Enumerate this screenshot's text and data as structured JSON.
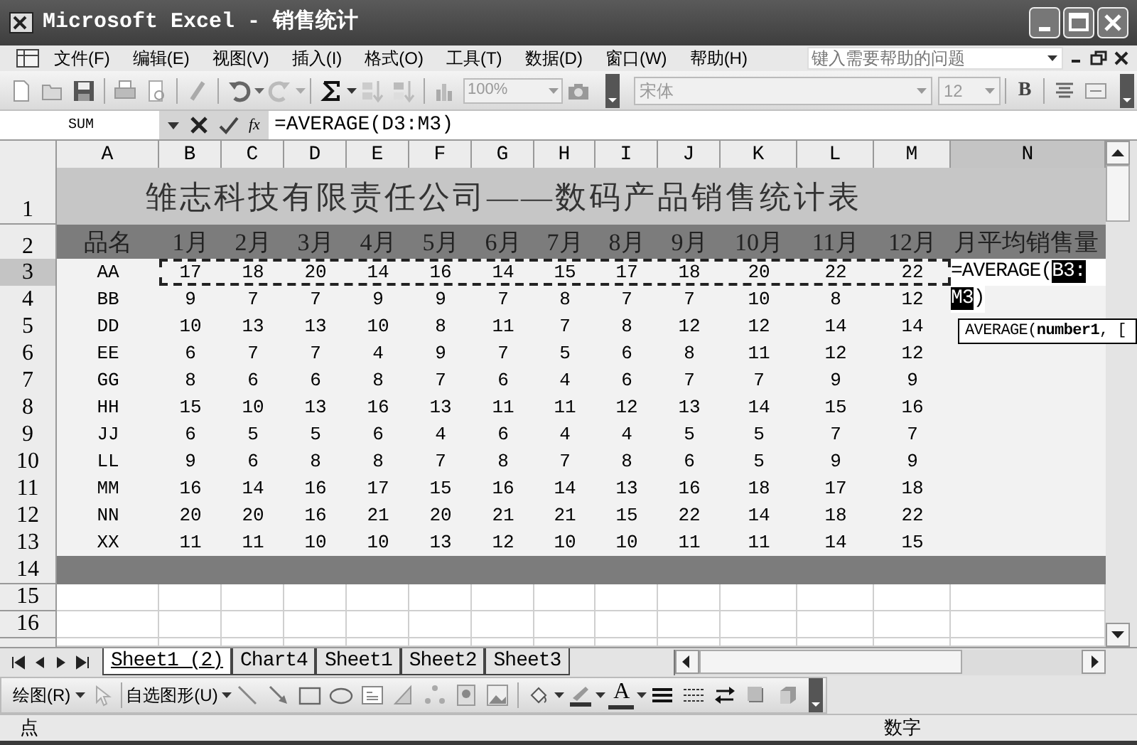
{
  "window": {
    "title": "Microsoft Excel - 销售统计"
  },
  "menu": [
    "文件(F)",
    "编辑(E)",
    "视图(V)",
    "插入(I)",
    "格式(O)",
    "工具(T)",
    "数据(D)",
    "窗口(W)",
    "帮助(H)"
  ],
  "help_box": {
    "placeholder": "键入需要帮助的问题"
  },
  "standard_toolbar": {
    "zoom": "100%"
  },
  "formatting_toolbar": {
    "font": "宋体",
    "size": "12",
    "bold_label": "B"
  },
  "formula_bar": {
    "name_box": "SUM",
    "function_label": "fx",
    "formula": "=AVERAGE(D3:M3)"
  },
  "columns": [
    {
      "label": "A",
      "selected": false
    },
    {
      "label": "B",
      "selected": false
    },
    {
      "label": "C",
      "selected": false
    },
    {
      "label": "D",
      "selected": false
    },
    {
      "label": "E",
      "selected": false
    },
    {
      "label": "F",
      "selected": false
    },
    {
      "label": "G",
      "selected": false
    },
    {
      "label": "H",
      "selected": false
    },
    {
      "label": "I",
      "selected": false
    },
    {
      "label": "J",
      "selected": false
    },
    {
      "label": "K",
      "selected": false
    },
    {
      "label": "L",
      "selected": false
    },
    {
      "label": "M",
      "selected": false
    },
    {
      "label": "N",
      "selected": true
    }
  ],
  "title_row": {
    "number": "1",
    "text": "雏志科技有限责任公司——数码产品销售统计表"
  },
  "header_row": {
    "number": "2",
    "cells": [
      "品名",
      "1月",
      "2月",
      "3月",
      "4月",
      "5月",
      "6月",
      "7月",
      "8月",
      "9月",
      "10月",
      "11月",
      "12月",
      "月平均销售量"
    ]
  },
  "data_rows": [
    {
      "number": "3",
      "selected": true,
      "cells": [
        "AA",
        "17",
        "18",
        "20",
        "14",
        "16",
        "14",
        "15",
        "17",
        "18",
        "20",
        "22",
        "22"
      ]
    },
    {
      "number": "4",
      "selected": false,
      "cells": [
        "BB",
        "9",
        "7",
        "7",
        "9",
        "9",
        "7",
        "8",
        "7",
        "7",
        "10",
        "8",
        "12"
      ]
    },
    {
      "number": "5",
      "selected": false,
      "cells": [
        "DD",
        "10",
        "13",
        "13",
        "10",
        "8",
        "11",
        "7",
        "8",
        "12",
        "12",
        "14",
        "14"
      ]
    },
    {
      "number": "6",
      "selected": false,
      "cells": [
        "EE",
        "6",
        "7",
        "7",
        "4",
        "9",
        "7",
        "5",
        "6",
        "8",
        "11",
        "12",
        "12"
      ]
    },
    {
      "number": "7",
      "selected": false,
      "cells": [
        "GG",
        "8",
        "6",
        "6",
        "8",
        "7",
        "6",
        "4",
        "6",
        "7",
        "7",
        "9",
        "9"
      ]
    },
    {
      "number": "8",
      "selected": false,
      "cells": [
        "HH",
        "15",
        "10",
        "13",
        "16",
        "13",
        "11",
        "11",
        "12",
        "13",
        "14",
        "15",
        "16"
      ]
    },
    {
      "number": "9",
      "selected": false,
      "cells": [
        "JJ",
        "6",
        "5",
        "5",
        "6",
        "4",
        "6",
        "4",
        "4",
        "5",
        "5",
        "7",
        "7"
      ]
    },
    {
      "number": "10",
      "selected": false,
      "cells": [
        "LL",
        "9",
        "6",
        "8",
        "8",
        "7",
        "8",
        "7",
        "8",
        "6",
        "5",
        "9",
        "9"
      ]
    },
    {
      "number": "11",
      "selected": false,
      "cells": [
        "MM",
        "16",
        "14",
        "16",
        "17",
        "15",
        "16",
        "14",
        "13",
        "16",
        "18",
        "17",
        "18"
      ]
    },
    {
      "number": "12",
      "selected": false,
      "cells": [
        "NN",
        "20",
        "20",
        "16",
        "21",
        "20",
        "21",
        "21",
        "15",
        "22",
        "14",
        "18",
        "22"
      ]
    },
    {
      "number": "13",
      "selected": false,
      "cells": [
        "XX",
        "11",
        "11",
        "10",
        "10",
        "13",
        "12",
        "10",
        "10",
        "11",
        "11",
        "14",
        "15"
      ]
    }
  ],
  "empty_rows": [
    {
      "number": "14",
      "kind": "band"
    },
    {
      "number": "15",
      "kind": "plain"
    },
    {
      "number": "16",
      "kind": "plain"
    },
    {
      "kind": "partial"
    }
  ],
  "cell_edit": {
    "lines": [
      [
        {
          "text": "=AVERAGE(",
          "selected": false
        },
        {
          "text": "B3:",
          "selected": true
        }
      ],
      [
        {
          "text": "M3",
          "selected": true
        },
        {
          "text": ")",
          "selected": false
        }
      ]
    ]
  },
  "tooltip": "AVERAGE(**number1**, [",
  "sheet_tabs": [
    {
      "label": "Sheet1 (2)",
      "selected": true
    },
    {
      "label": "Chart4",
      "selected": false
    },
    {
      "label": "Sheet1",
      "selected": false
    },
    {
      "label": "Sheet2",
      "selected": false
    },
    {
      "label": "Sheet3",
      "selected": false
    }
  ],
  "drawing_toolbar": {
    "draw_menu": "绘图(R)",
    "autoshapes_menu": "自选图形(U)",
    "font_color_label": "A"
  },
  "status_bar": {
    "mode": "点",
    "indicator": "数字"
  }
}
